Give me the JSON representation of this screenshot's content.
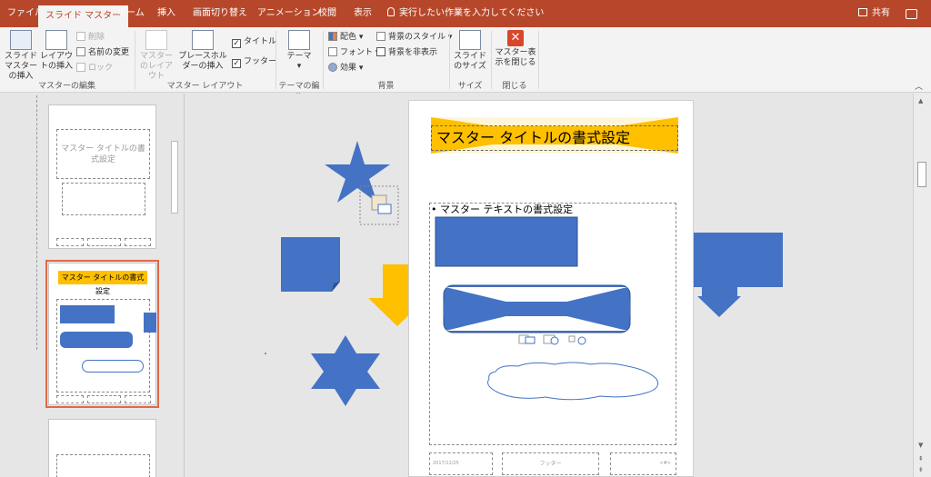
{
  "tabs": [
    {
      "label": "ファイル",
      "active": false
    },
    {
      "label": "スライド マスター",
      "active": true
    },
    {
      "label": "ホーム",
      "active": false
    },
    {
      "label": "挿入",
      "active": false
    },
    {
      "label": "画面切り替え",
      "active": false
    },
    {
      "label": "アニメーション",
      "active": false
    },
    {
      "label": "校閲",
      "active": false
    },
    {
      "label": "表示",
      "active": false
    }
  ],
  "tell_me": "実行したい作業を入力してください",
  "share": "共有",
  "ribbon": {
    "master_edit": {
      "label": "マスターの編集",
      "insert_slide_master": "スライド マスターの挿入",
      "insert_layout": "レイアウトの挿入",
      "delete": "削除",
      "rename": "名前の変更",
      "lock": "ロック"
    },
    "master_layout": {
      "label": "マスター レイアウト",
      "master_layout_btn": "マスターのレイアウト",
      "insert_placeholder": "プレースホルダーの挿入",
      "title_check": "タイトル",
      "footer_check": "フッター"
    },
    "theme_edit": {
      "label": "テーマの編集",
      "theme": "テーマ"
    },
    "background": {
      "label": "背景",
      "colors": "配色",
      "fonts": "フォント",
      "effects": "効果",
      "bg_styles": "背景のスタイル",
      "hide_bg": "背景を非表示"
    },
    "size": {
      "label": "サイズ",
      "slide_size": "スライドのサイズ"
    },
    "close": {
      "label": "閉じる",
      "close_master": "マスター表示を閉じる"
    }
  },
  "slide": {
    "title": "マスター タイトルの書式設定",
    "body": "• マスター テキストの書式設定",
    "footer_date": "2017/12/25",
    "footer_text": "フッター",
    "footer_num": "<#>"
  },
  "thumbs": {
    "t1_title": "マスター タイトルの書式設定",
    "t2_title": "マスター タイトルの書式設定"
  },
  "colors": {
    "accent": "#b7472a",
    "shape_blue": "#4472c4",
    "shape_gold": "#ffc000"
  }
}
